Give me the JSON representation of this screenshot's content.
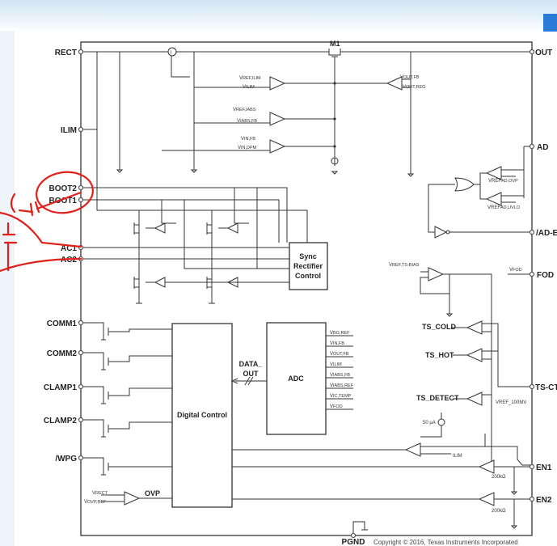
{
  "colors": {
    "accent": "#2a7bd6",
    "annotation": "#e0201a",
    "line": "#333333"
  },
  "pins_left": [
    "RECT",
    "ILIM",
    "BOOT2",
    "BOOT1",
    "AC1",
    "AC2",
    "COMM1",
    "COMM2",
    "CLAMP1",
    "CLAMP2",
    "/WPG"
  ],
  "pins_right": [
    "OUT",
    "AD",
    "/AD-E",
    "FOD",
    "TS-CT",
    "EN1",
    "EN2"
  ],
  "pin_bottom": "PGND",
  "copyright": "Copyright © 2016, Texas Instruments Incorporated",
  "blocks": {
    "m1": "M1",
    "sync1": "Sync",
    "sync2": "Rectifier",
    "sync3": "Control",
    "digital": "Digital Control",
    "adc": "ADC",
    "data_out1": "DATA_",
    "data_out2": "OUT",
    "ovp": "OVP",
    "current_sense": "I"
  },
  "comparators": [
    {
      "a": "V",
      "a_sub": "REF,ILIM",
      "b": "V",
      "b_sub": "ILIM"
    },
    {
      "a": "V",
      "a_sub": "REF,IABS",
      "b": "V",
      "b_sub": "IABS,FB"
    },
    {
      "a": "V",
      "a_sub": "IN,FB",
      "b": "V",
      "b_sub": "IN,DPM"
    },
    {
      "a": "V",
      "a_sub": "OUT,FB",
      "b": "V",
      "b_sub": "OUT,REG"
    }
  ],
  "ad_refs": [
    {
      "a": "VREF",
      "a_sub": "AD,OVP"
    },
    {
      "a": "VREF",
      "a_sub": "AD,UVLO"
    }
  ],
  "adc_inputs": [
    {
      "a": "V",
      "s": "BG,REF"
    },
    {
      "a": "V",
      "s": "IN,FB"
    },
    {
      "a": "V",
      "s": "OUT,FB"
    },
    {
      "a": "V",
      "s": "ILIM"
    },
    {
      "a": "V",
      "s": "IABS,FB"
    },
    {
      "a": "V",
      "s": "IABS,REF"
    },
    {
      "a": "V",
      "s": "IC,TEMP"
    },
    {
      "a": "V",
      "s": "FOD"
    }
  ],
  "ts": {
    "bias": "V",
    "bias_sub": "REF,TS-BIAS",
    "fod": "V",
    "fod_sub": "FOD",
    "cold": "TS_COLD",
    "hot": "TS_HOT",
    "detect": "TS_DETECT",
    "vref100": "VREF_100MV",
    "current": "50 µA"
  },
  "ilim_small": "ILIM",
  "res1": "200kΩ",
  "res2": "200kΩ",
  "ovp_in": {
    "a": "V",
    "a_sub": "RECT",
    "b": "V",
    "b_sub": "OVP,REF"
  }
}
